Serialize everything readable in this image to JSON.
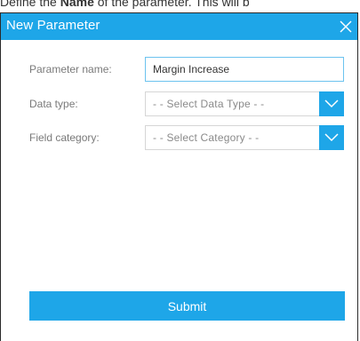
{
  "caption": {
    "prefix": "Define the ",
    "bold": "Name",
    "suffix": " of the parameter. This will b"
  },
  "dialog": {
    "title": "New Parameter",
    "close_icon": "close-icon"
  },
  "form": {
    "parameter_name": {
      "label": "Parameter name:",
      "value": "Margin Increase"
    },
    "data_type": {
      "label": "Data type:",
      "selected": "- - Select Data Type - -",
      "icon": "chevron-down-icon"
    },
    "field_category": {
      "label": "Field category:",
      "selected": "- - Select Category - -",
      "icon": "chevron-down-icon"
    }
  },
  "actions": {
    "submit_label": "Submit"
  },
  "colors": {
    "accent": "#1ea6e8",
    "input_border": "#6cc3ef",
    "label": "#7a7a7a"
  }
}
